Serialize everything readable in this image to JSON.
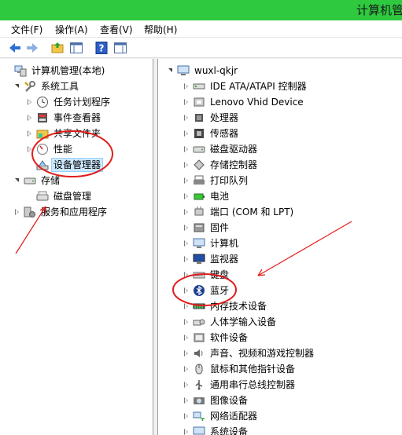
{
  "window": {
    "title": "计算机管理"
  },
  "menu": [
    {
      "label": "文件(F)"
    },
    {
      "label": "操作(A)"
    },
    {
      "label": "查看(V)"
    },
    {
      "label": "帮助(H)"
    }
  ],
  "left_tree": [
    {
      "label": "计算机管理(本地)",
      "arrow": "none",
      "icon": "computer-management-icon"
    },
    {
      "label": "系统工具",
      "arrow": "expanded",
      "icon": "tools-icon"
    },
    {
      "label": "任务计划程序",
      "arrow": "collapsed",
      "icon": "clock-icon"
    },
    {
      "label": "事件查看器",
      "arrow": "collapsed",
      "icon": "event-viewer-icon"
    },
    {
      "label": "共享文件夹",
      "arrow": "collapsed",
      "icon": "shared-folder-icon"
    },
    {
      "label": "性能",
      "arrow": "collapsed",
      "icon": "performance-icon"
    },
    {
      "label": "设备管理器",
      "arrow": "none",
      "icon": "device-manager-icon",
      "selected": true
    },
    {
      "label": "存储",
      "arrow": "expanded",
      "icon": "storage-icon"
    },
    {
      "label": "磁盘管理",
      "arrow": "none",
      "icon": "disk-management-icon"
    },
    {
      "label": "服务和应用程序",
      "arrow": "collapsed",
      "icon": "services-icon"
    }
  ],
  "right_tree": {
    "root": {
      "label": "wuxl-qkjr",
      "icon": "computer-icon"
    },
    "items": [
      {
        "label": "IDE ATA/ATAPI 控制器",
        "icon": "ide-controller-icon"
      },
      {
        "label": "Lenovo Vhid Device",
        "icon": "hid-device-icon"
      },
      {
        "label": "处理器",
        "icon": "processor-icon"
      },
      {
        "label": "传感器",
        "icon": "sensor-icon"
      },
      {
        "label": "磁盘驱动器",
        "icon": "disk-drive-icon"
      },
      {
        "label": "存储控制器",
        "icon": "storage-controller-icon"
      },
      {
        "label": "打印队列",
        "icon": "printer-icon"
      },
      {
        "label": "电池",
        "icon": "battery-icon"
      },
      {
        "label": "端口 (COM 和 LPT)",
        "icon": "port-icon"
      },
      {
        "label": "固件",
        "icon": "firmware-icon"
      },
      {
        "label": "计算机",
        "icon": "computer-icon"
      },
      {
        "label": "监视器",
        "icon": "monitor-icon"
      },
      {
        "label": "键盘",
        "icon": "keyboard-icon"
      },
      {
        "label": "蓝牙",
        "icon": "bluetooth-icon"
      },
      {
        "label": "内存技术设备",
        "icon": "memory-device-icon"
      },
      {
        "label": "人体学输入设备",
        "icon": "hid-input-icon"
      },
      {
        "label": "软件设备",
        "icon": "software-device-icon"
      },
      {
        "label": "声音、视频和游戏控制器",
        "icon": "sound-icon"
      },
      {
        "label": "鼠标和其他指针设备",
        "icon": "mouse-icon"
      },
      {
        "label": "通用串行总线控制器",
        "icon": "usb-icon"
      },
      {
        "label": "图像设备",
        "icon": "camera-icon"
      },
      {
        "label": "网络适配器",
        "icon": "network-adapter-icon"
      },
      {
        "label": "系统设备",
        "icon": "system-device-icon"
      }
    ]
  }
}
